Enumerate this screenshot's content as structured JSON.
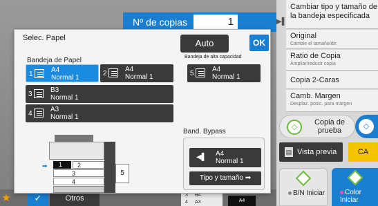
{
  "copies": {
    "label": "Nº de copias",
    "value": "1"
  },
  "right_panel": {
    "change_tray": "Cambiar tipo y tamaño de la bandeja especificada",
    "original_title": "Original",
    "original_sub": "Cambie el tamaño/dir.",
    "ratio_title": "Ratio de Copia",
    "ratio_sub": "Ampliar/reducir copia",
    "two_sided": "Copia 2-Caras",
    "margin_title": "Camb. Margen",
    "margin_sub": "Desplaz. posic. para margen",
    "sample": "Copia de prueba",
    "preview": "Vista previa",
    "ca": "CA",
    "bw_start": "B/N Iniciar",
    "color_start": "Color Iniciar"
  },
  "bottom": {
    "others": "Otros",
    "mini_trays": [
      {
        "num": "3",
        "size": "B4"
      },
      {
        "num": "4",
        "size": "A3"
      }
    ],
    "mini_paper": "A4"
  },
  "dialog": {
    "title": "Selec. Papel",
    "auto": "Auto",
    "ok": "OK",
    "tray_main_label": "Bandeja de Papel",
    "tray_high_label": "Bandeja de alta capacidad",
    "bypass_label": "Band. Bypass",
    "type_size": "Tipo y tamaño",
    "trays": [
      {
        "num": "1",
        "size": "A4",
        "type": "Normal 1",
        "selected": true
      },
      {
        "num": "2",
        "size": "A4",
        "type": "Normal 1",
        "selected": false
      },
      {
        "num": "3",
        "size": "B3",
        "type": "Normal 1",
        "selected": false
      },
      {
        "num": "4",
        "size": "A3",
        "type": "Normal 1",
        "selected": false
      },
      {
        "num": "5",
        "size": "A4",
        "type": "Normal 1",
        "selected": false
      }
    ],
    "bypass_tray": {
      "size": "A4",
      "type": "Normal 1"
    },
    "machine_labels": {
      "t1": "1",
      "t2": "2",
      "t3": "3",
      "t4": "4",
      "t5": "5"
    }
  },
  "colors": {
    "accent": "#1a7fd0",
    "ok": "#1a7fd0",
    "ca": "#f4c400",
    "start_green": "#6dbb3a"
  }
}
